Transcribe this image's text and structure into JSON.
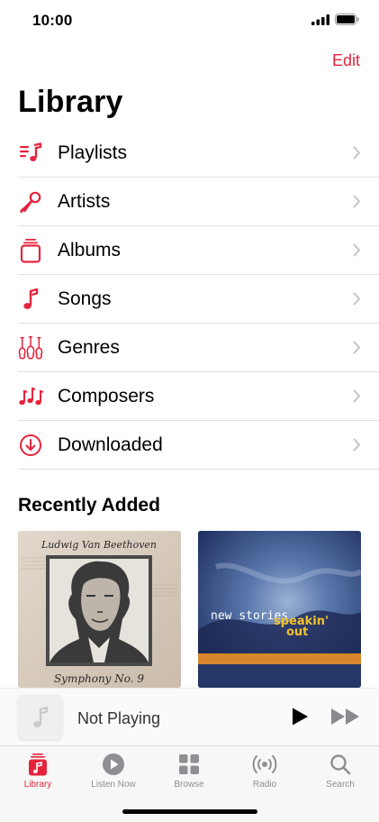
{
  "status": {
    "time": "10:00"
  },
  "header": {
    "edit_label": "Edit",
    "title": "Library"
  },
  "library_items": [
    {
      "label": "Playlists",
      "icon": "playlist-icon"
    },
    {
      "label": "Artists",
      "icon": "microphone-icon"
    },
    {
      "label": "Albums",
      "icon": "album-stack-icon"
    },
    {
      "label": "Songs",
      "icon": "music-note-icon"
    },
    {
      "label": "Genres",
      "icon": "guitars-icon"
    },
    {
      "label": "Composers",
      "icon": "music-notes-icon"
    },
    {
      "label": "Downloaded",
      "icon": "download-circle-icon"
    }
  ],
  "recently_added": {
    "title": "Recently Added",
    "albums": [
      {
        "cover_top_text": "Ludwig Van Beethoven",
        "cover_bottom_text": "Symphony No. 9"
      },
      {
        "cover_text_1": "new stories",
        "cover_text_2": "speakin'",
        "cover_text_3": "out"
      }
    ]
  },
  "mini_player": {
    "title": "Not Playing"
  },
  "tabs": [
    {
      "label": "Library",
      "icon": "library-icon",
      "active": true
    },
    {
      "label": "Listen Now",
      "icon": "play-circle-icon",
      "active": false
    },
    {
      "label": "Browse",
      "icon": "grid-icon",
      "active": false
    },
    {
      "label": "Radio",
      "icon": "radio-waves-icon",
      "active": false
    },
    {
      "label": "Search",
      "icon": "search-icon",
      "active": false
    }
  ],
  "colors": {
    "accent": "#e5243c",
    "tab_inactive": "#8e8e93",
    "divider": "#e1e1e3"
  }
}
